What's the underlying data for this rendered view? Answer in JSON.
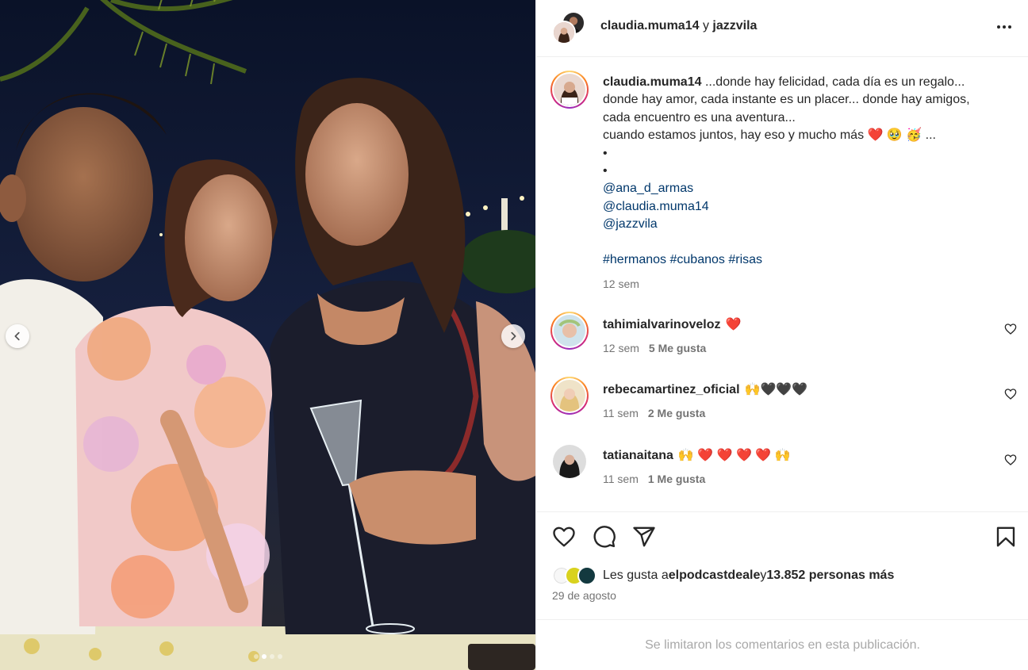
{
  "header": {
    "title_user1": "claudia.muma14",
    "title_joiner": " y ",
    "title_user2": "jazzvila"
  },
  "carousel": {
    "slide_count": 4,
    "active_slide": 2
  },
  "caption": {
    "username": "claudia.muma14",
    "lines": [
      "...donde hay felicidad, cada día es un regalo...",
      "donde hay amor, cada instante es un placer... donde hay amigos,",
      "cada encuentro es una aventura...",
      "cuando estamos juntos, hay eso y mucho más"
    ],
    "line4_emojis": "❤️ 🥹 🥳 ...",
    "bullets": [
      "•",
      "•"
    ],
    "mentions": [
      "@ana_d_armas",
      "@claudia.muma14",
      "@jazzvila"
    ],
    "hashtags": [
      "#hermanos",
      "#cubanos",
      "#risas"
    ],
    "time": "12 sem"
  },
  "comments": [
    {
      "username": "tahimialvarinoveloz",
      "text": "❤️",
      "time": "12 sem",
      "likes": "5 Me gusta",
      "story_ring": true
    },
    {
      "username": "rebecamartinez_oficial",
      "text": "🙌🖤🖤🖤",
      "time": "11 sem",
      "likes": "2 Me gusta",
      "story_ring": true
    },
    {
      "username": "tatianaitana",
      "text": "🙌 ❤️ ❤️ ❤️ ❤️ 🙌",
      "time": "11 sem",
      "likes": "1 Me gusta",
      "story_ring": false
    }
  ],
  "likes": {
    "prefix": "Les gusta a ",
    "user": "elpodcastdeale",
    "joiner": " y ",
    "others": "13.852 personas más"
  },
  "date": "29 de agosto",
  "footer_notice": "Se limitaron los comentarios en esta publicación.",
  "icons": [
    "chevron-left-icon",
    "chevron-right-icon",
    "more-icon",
    "heart-icon",
    "comment-icon",
    "share-icon",
    "bookmark-icon"
  ],
  "colors": {
    "link": "#00376b",
    "muted": "#737373",
    "footer_text": "#a8a8a8",
    "heart": "#e0245e"
  }
}
